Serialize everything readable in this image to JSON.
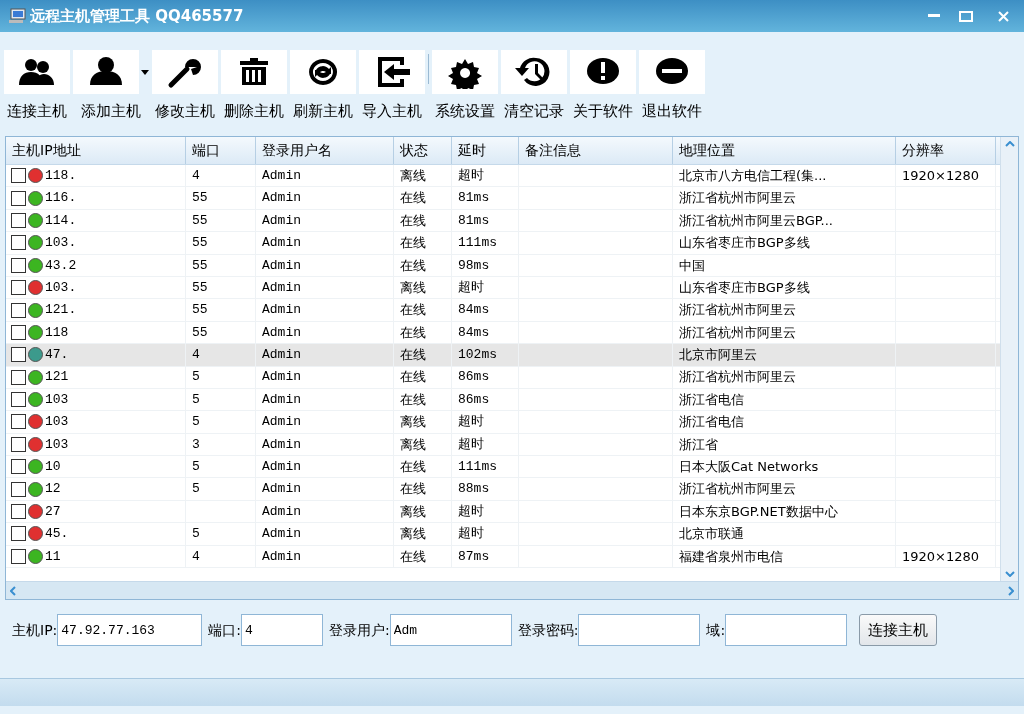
{
  "window": {
    "title": "远程主机管理工具 QQ465577"
  },
  "toolbar": [
    {
      "label": "连接主机",
      "dropdown": false
    },
    {
      "label": "添加主机",
      "dropdown": true
    },
    {
      "label": "修改主机",
      "dropdown": false
    },
    {
      "label": "删除主机",
      "dropdown": false
    },
    {
      "label": "刷新主机",
      "dropdown": false
    },
    {
      "label": "导入主机",
      "dropdown": false
    },
    {
      "label": "系统设置",
      "dropdown": false
    },
    {
      "label": "清空记录",
      "dropdown": false
    },
    {
      "label": "关于软件",
      "dropdown": false
    },
    {
      "label": "退出软件",
      "dropdown": false
    }
  ],
  "table": {
    "columns": [
      "主机IP地址",
      "端口",
      "登录用户名",
      "状态",
      "延时",
      "备注信息",
      "地理位置",
      "分辨率"
    ],
    "rows": [
      {
        "ip": "118.",
        "port": "4",
        "user": "Admin",
        "status": "离线",
        "delay": "超时",
        "location": "北京市八方电信工程(集...",
        "resolution": "1920×1280",
        "color": "#e03030",
        "selected": false,
        "checked": false
      },
      {
        "ip": "116.",
        "port": "55",
        "user": "Admin",
        "status": "在线",
        "delay": "81ms",
        "location": "浙江省杭州市阿里云",
        "color": "#3cb521",
        "selected": false,
        "checked": false
      },
      {
        "ip": "114.",
        "port": "55",
        "user": "Admin",
        "status": "在线",
        "delay": "81ms",
        "location": "浙江省杭州市阿里云BGP...",
        "color": "#3cb521",
        "selected": false,
        "checked": false
      },
      {
        "ip": "103.",
        "port": "55",
        "user": "Admin",
        "status": "在线",
        "delay": "111ms",
        "location": "山东省枣庄市BGP多线",
        "color": "#3cb521",
        "selected": false,
        "checked": false
      },
      {
        "ip": "43.2",
        "port": "55",
        "user": "Admin",
        "status": "在线",
        "delay": "98ms",
        "location": "中国",
        "color": "#3cb521",
        "selected": false,
        "checked": false
      },
      {
        "ip": "103.",
        "port": "55",
        "user": "Admin",
        "status": "离线",
        "delay": "超时",
        "location": "山东省枣庄市BGP多线",
        "color": "#e03030",
        "selected": false,
        "checked": false
      },
      {
        "ip": "121.",
        "port": "55",
        "user": "Admin",
        "status": "在线",
        "delay": "84ms",
        "location": "浙江省杭州市阿里云",
        "color": "#3cb521",
        "selected": false,
        "checked": false
      },
      {
        "ip": "118",
        "port": "55",
        "user": "Admin",
        "status": "在线",
        "delay": "84ms",
        "location": "浙江省杭州市阿里云",
        "color": "#3cb521",
        "selected": false,
        "checked": false
      },
      {
        "ip": "47.",
        "port": "4",
        "user": "Admin",
        "status": "在线",
        "delay": "102ms",
        "location": "北京市阿里云",
        "color": "#3c9a8c",
        "selected": true,
        "checked": false
      },
      {
        "ip": "121",
        "port": "5",
        "user": "Admin",
        "status": "在线",
        "delay": "86ms",
        "location": "浙江省杭州市阿里云",
        "color": "#3cb521",
        "selected": false,
        "checked": false
      },
      {
        "ip": "103",
        "port": "5",
        "user": "Admin",
        "status": "在线",
        "delay": "86ms",
        "location": "浙江省电信",
        "color": "#3cb521",
        "selected": false,
        "checked": false
      },
      {
        "ip": "103",
        "port": "5",
        "user": "Admin",
        "status": "离线",
        "delay": "超时",
        "location": "浙江省电信",
        "color": "#e03030",
        "selected": false,
        "checked": false
      },
      {
        "ip": "103",
        "port": "3",
        "user": "Admin",
        "status": "离线",
        "delay": "超时",
        "location": "浙江省",
        "color": "#e03030",
        "selected": false,
        "checked": false
      },
      {
        "ip": "10",
        "port": "5",
        "user": "Admin",
        "status": "在线",
        "delay": "111ms",
        "location": "日本大阪Cat Networks",
        "color": "#3cb521",
        "selected": false,
        "checked": false
      },
      {
        "ip": "12",
        "port": "5",
        "user": "Admin",
        "status": "在线",
        "delay": "88ms",
        "location": "浙江省杭州市阿里云",
        "color": "#3cb521",
        "selected": false,
        "checked": false
      },
      {
        "ip": "27",
        "user": "Admin",
        "status": "离线",
        "delay": "超时",
        "location": "日本东京BGP.NET数据中心",
        "color": "#e03030",
        "selected": false,
        "checked": false
      },
      {
        "ip": "45.",
        "port": "5",
        "user": "Admin",
        "status": "离线",
        "delay": "超时",
        "location": "北京市联通",
        "color": "#e03030",
        "selected": false,
        "checked": false
      },
      {
        "ip": "11",
        "port": "4",
        "user": "Admin",
        "status": "在线",
        "delay": "87ms",
        "location": "福建省泉州市电信",
        "resolution": "1920×1280",
        "color": "#3cb521",
        "selected": false,
        "checked": false
      }
    ]
  },
  "form": {
    "ip_label": "主机IP:",
    "ip_value": "47.92.77.163",
    "port_label": "端口:",
    "port_value": "4",
    "user_label": "登录用户:",
    "user_value": "Adm",
    "password_label": "登录密码:",
    "domain_label": "域:",
    "connect_button": "连接主机"
  }
}
